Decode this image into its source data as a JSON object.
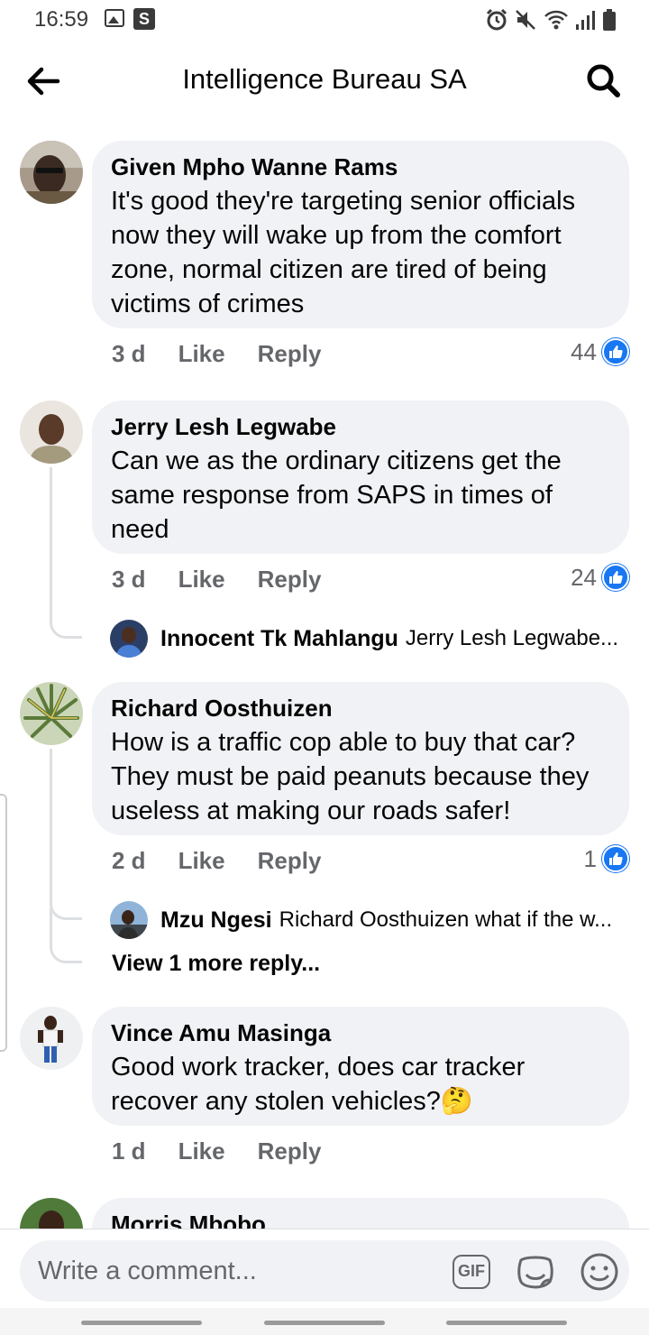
{
  "status_bar": {
    "time": "16:59",
    "s_badge": "S"
  },
  "header": {
    "title": "Intelligence Bureau SA"
  },
  "comments": [
    {
      "author": "Given Mpho Wanne Rams",
      "text": "It's good they're targeting senior officials now they will wake up from the comfort zone, normal citizen are tired of being victims of crimes",
      "time": "3 d",
      "like_label": "Like",
      "reply_label": "Reply",
      "likes": "44"
    },
    {
      "author": "Jerry Lesh Legwabe",
      "text": "Can we as the ordinary citizens get the same response from SAPS in times of need",
      "time": "3 d",
      "like_label": "Like",
      "reply_label": "Reply",
      "likes": "24",
      "reply": {
        "author": "Innocent Tk Mahlangu",
        "text": "Jerry Lesh Legwabe..."
      }
    },
    {
      "author": "Richard Oosthuizen",
      "text": "How is a traffic cop able to buy that car? They must be paid peanuts because they useless at making our roads safer!",
      "time": "2 d",
      "like_label": "Like",
      "reply_label": "Reply",
      "likes": "1",
      "reply": {
        "author": "Mzu Ngesi",
        "text": "Richard Oosthuizen what if the w..."
      },
      "view_more": "View 1 more reply..."
    },
    {
      "author": "Vince Amu Masinga",
      "text": "Good work tracker, does car tracker recover any stolen vehicles?🤔",
      "time": "1 d",
      "like_label": "Like",
      "reply_label": "Reply"
    },
    {
      "author": "Morris Mbobo"
    }
  ],
  "composer": {
    "placeholder": "Write a comment...",
    "gif_label": "GIF"
  },
  "colors": {
    "accent": "#1877f2",
    "bubble": "#f0f2f5",
    "muted": "#65676b"
  }
}
